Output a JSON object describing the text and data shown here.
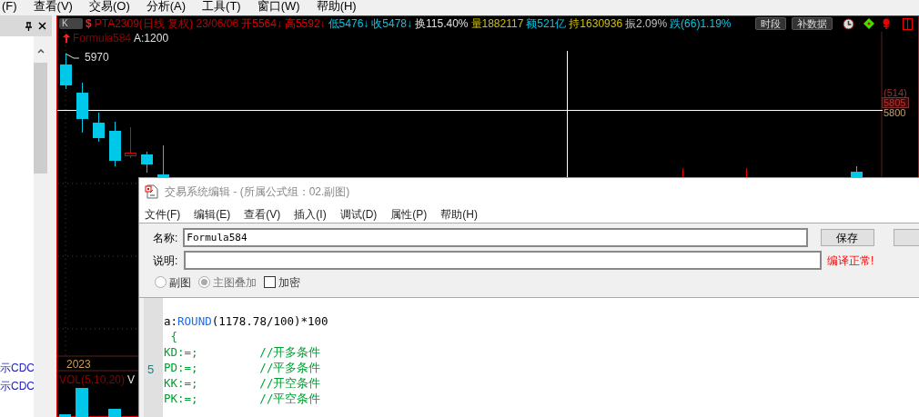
{
  "menu_bar": [
    "(F)",
    "查看(V)",
    "交易(O)",
    "分析(A)",
    "工具(T)",
    "窗口(W)",
    "帮助(H)"
  ],
  "left_panel": {
    "items": [
      "示CDC",
      "示CDC"
    ]
  },
  "chart": {
    "period_button": "K",
    "symbol_mark": "$",
    "quote": [
      {
        "text": "PTA2309(日线 复权) 23/06/06",
        "color": "#c00000"
      },
      {
        "text": "开5564↓",
        "color": "#e00000"
      },
      {
        "text": "高5592↓",
        "color": "#e00000"
      },
      {
        "text": "低5476↓",
        "color": "#00c8e8"
      },
      {
        "text": "收5478↓",
        "color": "#00c8e8"
      },
      {
        "text": "换115.40%",
        "color": "#e0e0e0"
      },
      {
        "text": "量1882117",
        "color": "#d0c000"
      },
      {
        "text": "额521亿",
        "color": "#00c8e8"
      },
      {
        "text": "持1630936",
        "color": "#d0c000"
      },
      {
        "text": "振2.09%",
        "color": "#c0c0c0"
      },
      {
        "text": "跌(66)1.19%",
        "color": "#00c8e8"
      }
    ],
    "buttons": [
      "时段",
      "补数据"
    ],
    "formula_name": "Formula584",
    "formula_value": "A:1200",
    "high_label": "5970",
    "axis_labels": [
      {
        "text": "(514)",
        "highlighted": false
      },
      {
        "text": "5805",
        "highlighted": true
      },
      {
        "text": "5800",
        "highlighted": false
      }
    ],
    "year_label": "2023",
    "volume_label": "VOL(5,10,20)",
    "volume_label_2": "V"
  },
  "dialog": {
    "title": "交易系统编辑 - (所属公式组：02.副图)",
    "menu": [
      "文件(F)",
      "编辑(E)",
      "查看(V)",
      "插入(I)",
      "调试(D)",
      "属性(P)",
      "帮助(H)"
    ],
    "name_label": "名称:",
    "name_value": "Formula584",
    "save_button": "保存",
    "description_label": "说明:",
    "status": "编译正常!",
    "options": [
      {
        "kind": "radio",
        "label": "副图",
        "selected": false,
        "disabled": false
      },
      {
        "kind": "radio",
        "label": "主图叠加",
        "selected": true,
        "disabled": true
      },
      {
        "kind": "checkbox",
        "label": "加密",
        "checked": false
      }
    ],
    "line_number": "5",
    "code": [
      [
        {
          "kind": "plain",
          "text": "a:"
        },
        {
          "kind": "function",
          "text": "ROUND"
        },
        {
          "kind": "plain",
          "text": "(1178.78/100)*100"
        }
      ],
      [
        {
          "kind": "comment",
          "text": " {"
        }
      ],
      [
        {
          "kind": "comment",
          "text": "KD:=;         //开多条件"
        }
      ],
      [
        {
          "kind": "comment",
          "text": "PD:=;         //平多条件"
        }
      ],
      [
        {
          "kind": "comment",
          "text": "KK:=;         //开空条件"
        }
      ],
      [
        {
          "kind": "comment",
          "text": "PK:=;         //平空条件"
        }
      ]
    ]
  }
}
